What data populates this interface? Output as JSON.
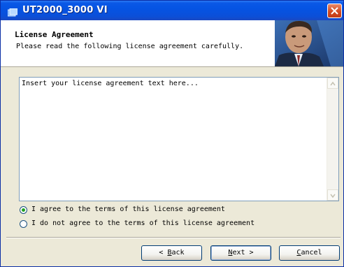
{
  "window": {
    "title": "UT2000_3000 VI"
  },
  "header": {
    "title": "License Agreement",
    "subtitle": "Please read the following license agreement carefully."
  },
  "license": {
    "text": "Insert your license agreement text here..."
  },
  "options": [
    {
      "label": "I agree to the terms of this license agreement",
      "selected": true
    },
    {
      "label": "I do not agree to the terms of this license agreement",
      "selected": false
    }
  ],
  "buttons": {
    "back": {
      "prefix": "< ",
      "mnemonic": "B",
      "rest": "ack"
    },
    "next": {
      "mnemonic": "N",
      "rest": "ext",
      "suffix": " >"
    },
    "cancel": {
      "mnemonic": "C",
      "rest": "ancel"
    }
  },
  "colors": {
    "titlebar": "#0554e3",
    "radio_selected": "#21a121",
    "dialog_bg": "#ece9d8"
  }
}
